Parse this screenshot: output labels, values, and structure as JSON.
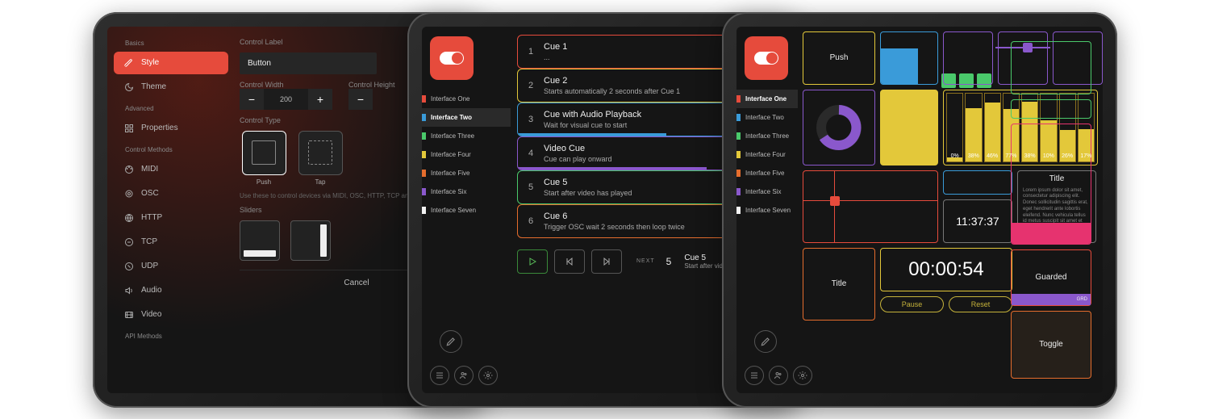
{
  "editor": {
    "sections": {
      "basics": "Basics",
      "advanced": "Advanced",
      "control_methods": "Control Methods",
      "api_methods": "API Methods"
    },
    "nav": {
      "style": "Style",
      "theme": "Theme",
      "properties": "Properties",
      "midi": "MIDI",
      "osc": "OSC",
      "http": "HTTP",
      "tcp": "TCP",
      "udp": "UDP",
      "audio": "Audio",
      "video": "Video"
    },
    "fields": {
      "control_label": "Control Label",
      "control_label_value": "Button",
      "control_width": "Control Width",
      "control_width_value": "200",
      "control_height": "Control Height",
      "control_type": "Control Type",
      "push": "Push",
      "tap": "Tap",
      "hint": "Use these to control devices via MIDI, OSC, HTTP, TCP and ...",
      "sliders": "Sliders"
    },
    "cancel": "Cancel"
  },
  "interfaces": [
    {
      "label": "Interface One",
      "color": "#e64b3c"
    },
    {
      "label": "Interface Two",
      "color": "#3a9bd9"
    },
    {
      "label": "Interface Three",
      "color": "#4ac96b"
    },
    {
      "label": "Interface Four",
      "color": "#e3c83a"
    },
    {
      "label": "Interface Five",
      "color": "#e56d2d"
    },
    {
      "label": "Interface Six",
      "color": "#8a58cc"
    },
    {
      "label": "Interface Seven",
      "color": "#f2f2f2"
    }
  ],
  "cues": [
    {
      "n": "1",
      "title": "Cue 1",
      "sub": "...",
      "color": "#e64b3c",
      "progress": 0
    },
    {
      "n": "2",
      "title": "Cue 2",
      "sub": "Starts automatically 2 seconds after Cue 1",
      "color": "#e3c83a",
      "progress": 0
    },
    {
      "n": "3",
      "title": "Cue with Audio Playback",
      "sub": "Wait for visual cue to start",
      "color": "#3a9bd9",
      "progress": 55
    },
    {
      "n": "4",
      "title": "Video Cue",
      "sub": "Cue can play onward",
      "color": "#8a58cc",
      "progress": 70
    },
    {
      "n": "5",
      "title": "Cue 5",
      "sub": "Start after video has played",
      "color": "#4ac96b",
      "progress": 0
    },
    {
      "n": "6",
      "title": "Cue 6",
      "sub": "Trigger OSC wait 2 seconds then loop twice",
      "color": "#e56d2d",
      "progress": 0
    }
  ],
  "transport": {
    "next_label": "NEXT",
    "next_num": "5",
    "next_title": "Cue 5",
    "next_sub": "Start after video has played"
  },
  "dashboard": {
    "push": "Push",
    "guarded": "Guarded",
    "guarded_sub": "GRD",
    "toggle": "Toggle",
    "title": "Title",
    "time_small": "11:37:37",
    "time_big": "00:00:54",
    "pause": "Pause",
    "reset": "Reset",
    "lorem_head": "Title",
    "lorem_body": "Lorem ipsum dolor sit amet, consectetur adipiscing elit. Donec sollicitudin sagittis erat, eget hendrerit ante lobortis eleifend. Nunc vehicula tellus id metus suscipit sit amet et eaque rutrum ultrices. Aliquam id laoreet sapien. In hac habitasse platea dictumst. Vestibulum est maximus. In hac habitasse platea dictumst. Sed id imperdiet ligula. Duis egestas, libero risus, malesuada mauris dictum ac. Proin pharetra consectetur.",
    "levels": [
      {
        "label": "0%",
        "pct": 5,
        "color": "#e3c83a"
      },
      {
        "label": "38%",
        "pct": 78,
        "color": "#e3c83a"
      },
      {
        "label": "46%",
        "pct": 86,
        "color": "#e3c83a"
      },
      {
        "label": "77%",
        "pct": 77,
        "color": "#e3c83a"
      },
      {
        "label": "38%",
        "pct": 88,
        "color": "#e3c83a"
      },
      {
        "label": "10%",
        "pct": 60,
        "color": "#e3c83a"
      },
      {
        "label": "26%",
        "pct": 46,
        "color": "#e3c83a"
      },
      {
        "label": "17%",
        "pct": 47,
        "color": "#e3c83a"
      }
    ],
    "palette": {
      "red": "#e64b3c",
      "blue": "#3a9bd9",
      "green": "#4ac96b",
      "yellow": "#e3c83a",
      "orange": "#e56d2d",
      "purple": "#8a58cc",
      "pink": "#e6336f"
    }
  }
}
